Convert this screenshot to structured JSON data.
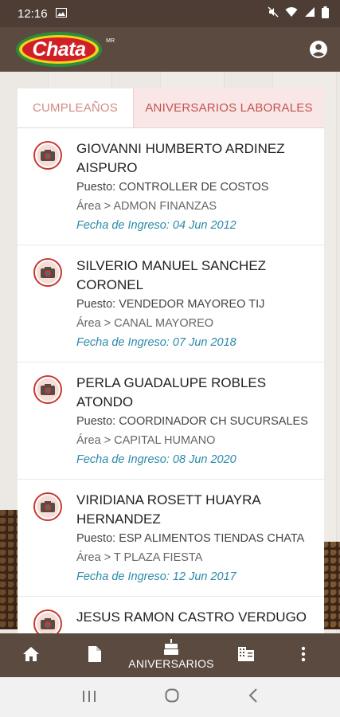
{
  "status_bar": {
    "time": "12:16"
  },
  "app": {
    "logo_text": "Chata",
    "logo_tm": "MR"
  },
  "tabs": [
    {
      "label": "CUMPLEAÑOS"
    },
    {
      "label": "ANIVERSARIOS LABORALES"
    }
  ],
  "employees": [
    {
      "name": "GIOVANNI HUMBERTO ARDINEZ AISPURO",
      "puesto": "Puesto: CONTROLLER DE COSTOS",
      "area": "Área > ADMON FINANZAS",
      "fecha": "Fecha de Ingreso: 04 Jun 2012"
    },
    {
      "name": "SILVERIO MANUEL SANCHEZ CORONEL",
      "puesto": "Puesto: VENDEDOR MAYOREO TIJ",
      "area": "Área > CANAL MAYOREO",
      "fecha": "Fecha de Ingreso: 07 Jun 2018"
    },
    {
      "name": "PERLA GUADALUPE ROBLES ATONDO",
      "puesto": "Puesto: COORDINADOR CH SUCURSALES",
      "area": "Área > CAPITAL HUMANO",
      "fecha": "Fecha de Ingreso: 08 Jun 2020"
    },
    {
      "name": "VIRIDIANA ROSETT HUAYRA HERNANDEZ",
      "puesto": "Puesto: ESP ALIMENTOS TIENDAS CHATA",
      "area": "Área > T PLAZA FIESTA",
      "fecha": "Fecha de Ingreso: 12 Jun 2017"
    },
    {
      "name": "JESUS RAMON CASTRO VERDUGO"
    }
  ],
  "bottom_nav": {
    "anniversaries_label": "ANIVERSARIOS"
  },
  "colors": {
    "brand_brown": "#5a4a40",
    "accent_red": "#c4534e",
    "date_teal": "#2a8aa8"
  }
}
